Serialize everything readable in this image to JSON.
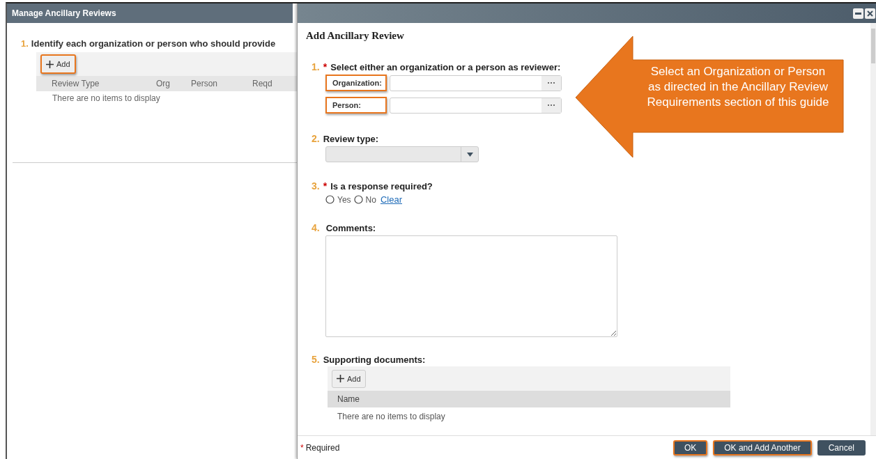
{
  "background_window": {
    "title": "Manage Ancillary Reviews",
    "step": {
      "number": "1.",
      "label": "Identify each organization or person who should provide"
    },
    "add_button": {
      "label": "Add",
      "highlighted": true
    },
    "table": {
      "columns": [
        "Review Type",
        "Org",
        "Person",
        "Reqd"
      ],
      "empty_text": "There are no items to display"
    }
  },
  "dialog": {
    "title": "Add Ancillary Review",
    "questions": [
      {
        "kind": "lookup",
        "number": "1.",
        "required_marker": "*",
        "label": "Select either an organization or a person as reviewer:",
        "fields": [
          {
            "label": "Organization:",
            "highlighted": true
          },
          {
            "label": "Person:",
            "highlighted": true
          }
        ]
      },
      {
        "kind": "select",
        "number": "2.",
        "label": "Review type:"
      },
      {
        "kind": "radio",
        "number": "3.",
        "required_marker": "*",
        "label": "Is a response required?",
        "options": [
          {
            "label": "Yes",
            "selected": false
          },
          {
            "label": "No",
            "selected": false
          }
        ],
        "clear_link": "Clear"
      },
      {
        "kind": "textarea",
        "number": "4.",
        "label": "Comments:"
      },
      {
        "kind": "documents",
        "number": "5.",
        "label": "Supporting documents:",
        "add_button": "Add",
        "columns": [
          "Name"
        ],
        "empty_text": "There are no items to display"
      }
    ],
    "footer": {
      "required_marker": "*",
      "required_note": "Required",
      "buttons": [
        {
          "label": "OK",
          "highlighted": true
        },
        {
          "label": "OK and Add Another",
          "highlighted": true
        },
        {
          "label": "Cancel",
          "highlighted": false
        }
      ]
    }
  },
  "callout": {
    "text": "Select an Organization or Person as directed in the Ancillary Review Requirements section of this guide"
  }
}
